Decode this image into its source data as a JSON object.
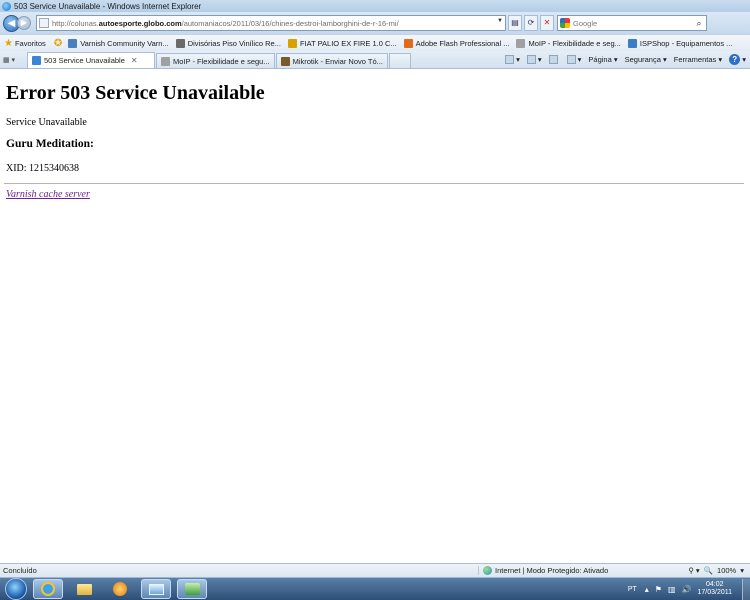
{
  "window": {
    "title": "503 Service Unavailable - Windows Internet Explorer"
  },
  "address": {
    "url_prefix": "http://colunas.",
    "url_domain": "autoesporte.globo.com",
    "url_suffix": "/automaniacos/2011/03/16/chines-destroi-lamborghini-de-r-16-mi/",
    "search_placeholder": "Google"
  },
  "favorites": {
    "label": "Favoritos",
    "items": [
      {
        "label": "Varnish Community  Varn...",
        "color": "#4a7fc0"
      },
      {
        "label": "Divisórias Piso Vinílico Re...",
        "color": "#6a6a6a"
      },
      {
        "label": "FIAT PALIO EX FIRE 1.0 C...",
        "color": "#d9a100"
      },
      {
        "label": "Adobe Flash Professional ...",
        "color": "#e06a1a"
      },
      {
        "label": "MoIP - Flexibilidade e seg...",
        "color": "#a0a0a0"
      },
      {
        "label": "ISPShop - Equipamentos ...",
        "color": "#3b7cc9"
      }
    ]
  },
  "tabs": [
    {
      "label": "503 Service Unavailable",
      "active": true,
      "color": "#3a86d6"
    },
    {
      "label": "MoIP - Flexibilidade e segu...",
      "active": false,
      "color": "#a0a0a0"
    },
    {
      "label": "Mikrotik - Enviar Novo Tó...",
      "active": false,
      "color": "#7a5a2a"
    }
  ],
  "commands": {
    "page": "Página",
    "security": "Segurança",
    "tools": "Ferramentas"
  },
  "page": {
    "heading": "Error 503 Service Unavailable",
    "message": "Service Unavailable",
    "subheading": "Guru Meditation:",
    "xid": "XID: 1215340638",
    "footer_link": "Varnish cache server"
  },
  "status": {
    "text": "Concluído",
    "zone": "Internet | Modo Protegido: Ativado",
    "zoom": "100%"
  },
  "taskbar": {
    "language": "PT",
    "time": "04:02",
    "date": "17/03/2011"
  }
}
